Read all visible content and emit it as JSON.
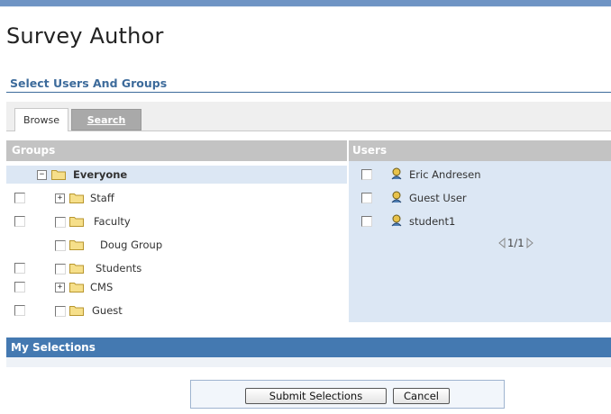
{
  "page": {
    "title": "Survey Author"
  },
  "section": {
    "title": "Select Users And Groups"
  },
  "tabs": {
    "browse": "Browse",
    "search": "Search"
  },
  "groups": {
    "header": "Groups",
    "items": [
      {
        "label": "Everyone",
        "expander": "−",
        "has_checkbox": false,
        "selected": true
      },
      {
        "label": "Staff",
        "expander": "+",
        "has_checkbox": true
      },
      {
        "label": "Faculty",
        "expander": "",
        "has_checkbox": true
      },
      {
        "label": "Doug Group",
        "expander": "",
        "has_checkbox": false
      },
      {
        "label": "Students",
        "expander": "",
        "has_checkbox": true
      },
      {
        "label": "CMS",
        "expander": "+",
        "has_checkbox": true
      },
      {
        "label": "Guest",
        "expander": "",
        "has_checkbox": true
      }
    ]
  },
  "users": {
    "header": "Users",
    "items": [
      {
        "label": "Eric Andresen"
      },
      {
        "label": "Guest User"
      },
      {
        "label": "student1"
      }
    ],
    "pager": "1/1"
  },
  "my_selections": {
    "title": "My Selections"
  },
  "buttons": {
    "submit": "Submit Selections",
    "cancel": "Cancel"
  },
  "colors": {
    "accent": "#4479b1",
    "title_blue": "#3d6b9b",
    "panel_header": "#c3c3c3",
    "users_bg": "#dce7f4"
  }
}
